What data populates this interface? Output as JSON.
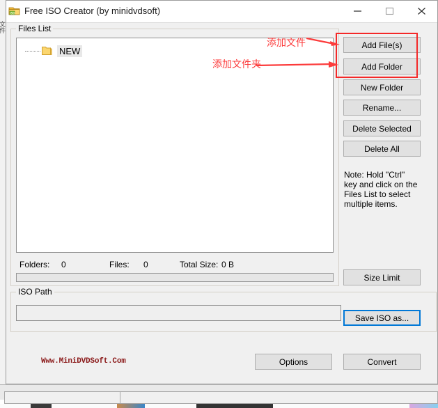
{
  "window": {
    "title": "Free ISO Creator (by minidvdsoft)",
    "icon": "app-folder-icon",
    "minimize_label": "—",
    "maximize_label": "□",
    "close_label": "✕"
  },
  "files_list": {
    "group_label": "Files List",
    "tree_items": [
      {
        "label": "NEW",
        "icon": "folder-icon"
      }
    ]
  },
  "stats": {
    "folders_label": "Folders:",
    "folders_value": "0",
    "files_label": "Files:",
    "files_value": "0",
    "total_size_label": "Total Size:",
    "total_size_value": "0 B"
  },
  "iso_path": {
    "group_label": "ISO Path",
    "value": "",
    "placeholder": ""
  },
  "buttons": {
    "add_files": "Add File(s)",
    "add_folder": "Add Folder",
    "new_folder": "New Folder",
    "rename": "Rename...",
    "delete_selected": "Delete Selected",
    "delete_all": "Delete All",
    "size_limit": "Size Limit",
    "save_iso_as": "Save ISO as...",
    "options": "Options",
    "convert": "Convert"
  },
  "note": {
    "text": "Note: Hold \"Ctrl\" key and click on the Files List to select multiple items."
  },
  "footer": {
    "site": "Www.MiniDVDSoft.Com"
  },
  "annotations": {
    "add_file_note": "添加文件",
    "add_folder_note": "添加文件夹",
    "highlight_color": "#f42929",
    "text_color": "#fc3b3b"
  },
  "background_window": {
    "edge_text": "文件"
  },
  "colors": {
    "window_bg": "#f0f0f0",
    "button_face": "#e1e1e1",
    "button_border": "#adadad",
    "focus_blue": "#0078d7",
    "field_bg": "#ffffff",
    "site_red": "#8b1a1a",
    "folder_yellow": "#f7d77c"
  }
}
